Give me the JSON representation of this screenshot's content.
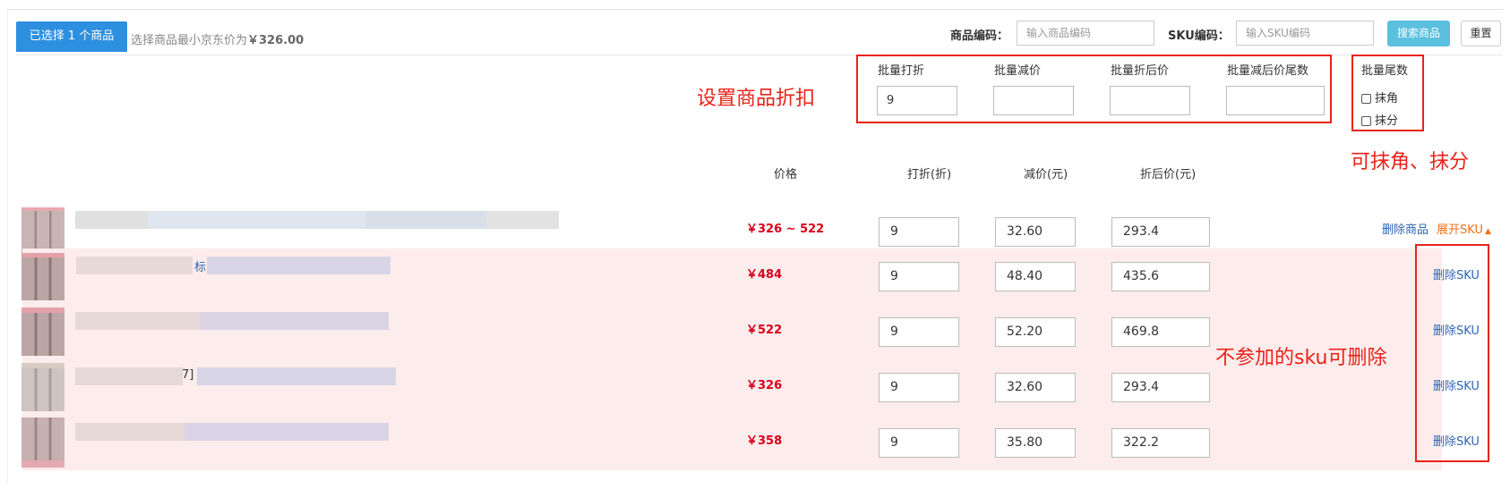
{
  "toolbar": {
    "selected_tab": "已选择 1 个商品",
    "min_price_prefix": "选择商品最小京东价为",
    "min_price_value": "￥326.00",
    "product_code_label": "商品编码：",
    "product_code_placeholder": "输入商品编码",
    "sku_code_label": "SKU编码：",
    "sku_code_placeholder": "输入SKU编码",
    "search_button": "搜索商品",
    "reset_button": "重置"
  },
  "batch": {
    "discount_label": "批量打折",
    "discount_value": "9",
    "reduce_label": "批量减价",
    "reduce_value": "",
    "after_price_label": "批量折后价",
    "after_price_value": "",
    "tail_label": "批量减后价尾数",
    "tail_value": "",
    "tail_mode_label": "批量尾数",
    "option_jiao": "抹角",
    "option_fen": "抹分"
  },
  "annotations": {
    "set_discount": "设置商品折扣",
    "round_off": "可抹角、抹分",
    "delete_sku": "不参加的sku可删除"
  },
  "columns": {
    "price": "价格",
    "discount": "打折(折)",
    "reduce": "减价(元)",
    "after": "折后价(元)"
  },
  "product": {
    "price_range": "￥326 ~ 522",
    "discount": "9",
    "reduce": "32.60",
    "after": "293.4",
    "delete_label": "删除商品",
    "expand_label": "展开SKU"
  },
  "skus": [
    {
      "price": "￥484",
      "discount": "9",
      "reduce": "48.40",
      "after": "435.6",
      "delete_label": "删除SKU",
      "title_fragment": "标"
    },
    {
      "price": "￥522",
      "discount": "9",
      "reduce": "52.20",
      "after": "469.8",
      "delete_label": "删除SKU",
      "title_fragment": ""
    },
    {
      "price": "￥326",
      "discount": "9",
      "reduce": "32.60",
      "after": "293.4",
      "delete_label": "删除SKU",
      "title_fragment": "7]"
    },
    {
      "price": "￥358",
      "discount": "9",
      "reduce": "35.80",
      "after": "322.2",
      "delete_label": "删除SKU",
      "title_fragment": ""
    }
  ],
  "colors": {
    "accent_blue": "#2d8fe0",
    "search_button": "#5bc0de",
    "price_red": "#d9001b",
    "annotation_red": "#e8231a",
    "sku_row_bg": "#fdecec",
    "link_blue": "#2d64b3",
    "expand_orange": "#f36e16"
  }
}
